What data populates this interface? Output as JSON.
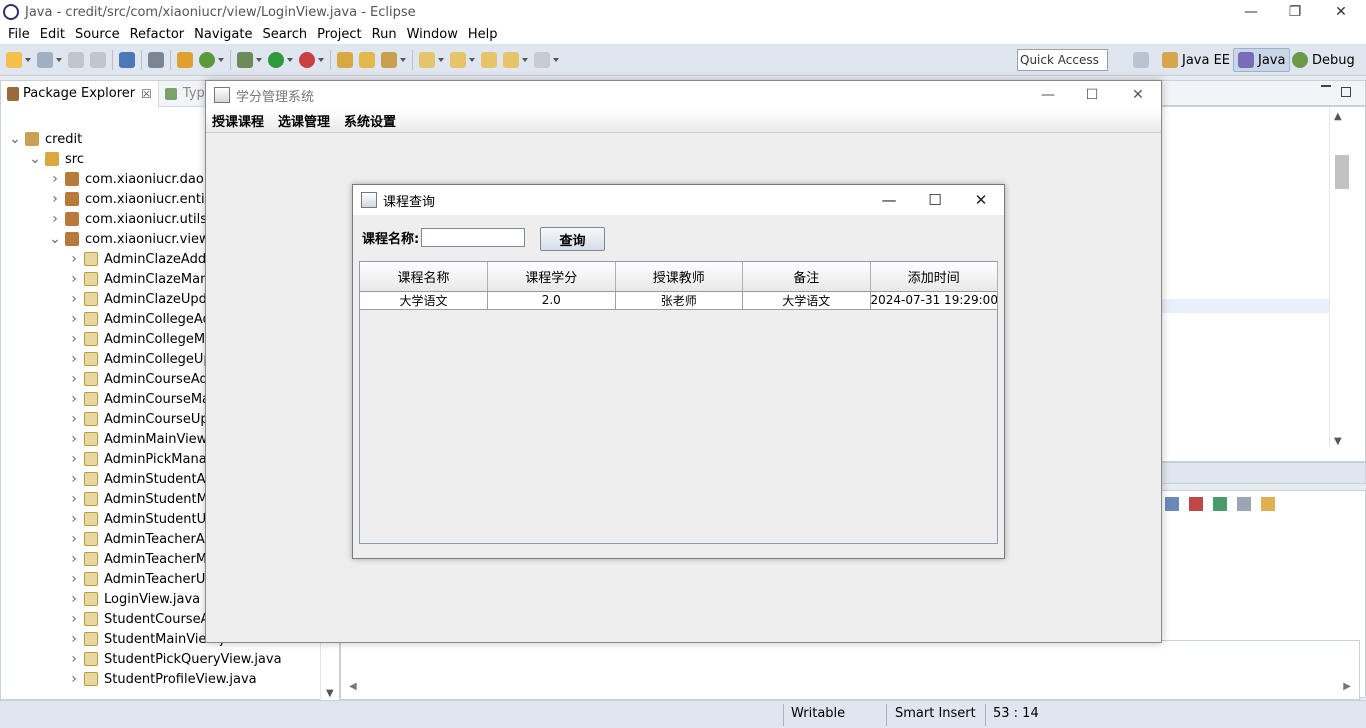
{
  "window": {
    "title": "Java - credit/src/com/xiaoniucr/view/LoginView.java - Eclipse"
  },
  "menu": [
    "File",
    "Edit",
    "Source",
    "Refactor",
    "Navigate",
    "Search",
    "Project",
    "Run",
    "Window",
    "Help"
  ],
  "quick_access": {
    "placeholder": "Quick Access"
  },
  "perspectives": [
    "Java EE",
    "Java",
    "Debug"
  ],
  "package_explorer": {
    "tab_label": "Package Explorer",
    "tab_close": "☒",
    "second_tab": "Type",
    "tree": [
      {
        "label": "credit",
        "level": 0,
        "expanded": true,
        "kind": "project"
      },
      {
        "label": "src",
        "level": 1,
        "expanded": true,
        "kind": "src"
      },
      {
        "label": "com.xiaoniucr.dao",
        "level": 2,
        "expanded": false,
        "kind": "package"
      },
      {
        "label": "com.xiaoniucr.entity",
        "level": 2,
        "expanded": false,
        "kind": "package"
      },
      {
        "label": "com.xiaoniucr.utils",
        "level": 2,
        "expanded": false,
        "kind": "package"
      },
      {
        "label": "com.xiaoniucr.view",
        "level": 2,
        "expanded": true,
        "kind": "package"
      },
      {
        "label": "AdminClazeAddV",
        "level": 3,
        "expanded": false,
        "kind": "java"
      },
      {
        "label": "AdminClazeMana",
        "level": 3,
        "expanded": false,
        "kind": "java"
      },
      {
        "label": "AdminClazeUpda",
        "level": 3,
        "expanded": false,
        "kind": "java"
      },
      {
        "label": "AdminCollegeAdc",
        "level": 3,
        "expanded": false,
        "kind": "java"
      },
      {
        "label": "AdminCollegeMa",
        "level": 3,
        "expanded": false,
        "kind": "java"
      },
      {
        "label": "AdminCollegeUpc",
        "level": 3,
        "expanded": false,
        "kind": "java"
      },
      {
        "label": "AdminCourseAdd",
        "level": 3,
        "expanded": false,
        "kind": "java"
      },
      {
        "label": "AdminCourseMan",
        "level": 3,
        "expanded": false,
        "kind": "java"
      },
      {
        "label": "AdminCourseUpc",
        "level": 3,
        "expanded": false,
        "kind": "java"
      },
      {
        "label": "AdminMainView.j",
        "level": 3,
        "expanded": false,
        "kind": "java"
      },
      {
        "label": "AdminPickManag",
        "level": 3,
        "expanded": false,
        "kind": "java"
      },
      {
        "label": "AdminStudentAdc",
        "level": 3,
        "expanded": false,
        "kind": "java"
      },
      {
        "label": "AdminStudentMa",
        "level": 3,
        "expanded": false,
        "kind": "java"
      },
      {
        "label": "AdminStudentUpc",
        "level": 3,
        "expanded": false,
        "kind": "java"
      },
      {
        "label": "AdminTeacherAd",
        "level": 3,
        "expanded": false,
        "kind": "java"
      },
      {
        "label": "AdminTeacherMa",
        "level": 3,
        "expanded": false,
        "kind": "java"
      },
      {
        "label": "AdminTeacherUp",
        "level": 3,
        "expanded": false,
        "kind": "java"
      },
      {
        "label": "LoginView.java",
        "level": 3,
        "expanded": false,
        "kind": "java"
      },
      {
        "label": "StudentCourseAll",
        "level": 3,
        "expanded": false,
        "kind": "java"
      },
      {
        "label": "StudentMainView.java",
        "level": 3,
        "expanded": false,
        "kind": "java"
      },
      {
        "label": "StudentPickQueryView.java",
        "level": 3,
        "expanded": false,
        "kind": "java"
      },
      {
        "label": "StudentProfileView.java",
        "level": 3,
        "expanded": false,
        "kind": "java"
      }
    ]
  },
  "main_frame": {
    "title": "学分管理系统",
    "menus": [
      "授课课程",
      "选课管理",
      "系统设置"
    ]
  },
  "inner_frame": {
    "title": "课程查询",
    "search_label": "课程名称:",
    "search_value": "",
    "search_button": "查询",
    "table": {
      "headers": [
        "课程名称",
        "课程学分",
        "授课教师",
        "备注",
        "添加时间"
      ],
      "rows": [
        [
          "大学语文",
          "2.0",
          "张老师",
          "大学语文",
          "2024-07-31 19:29:00"
        ]
      ]
    }
  },
  "status": {
    "writable": "Writable",
    "insert_mode": "Smart Insert",
    "position": "53 : 14"
  },
  "colors": {
    "toolbar": "#dfe6ef",
    "accent": "#c8d6e8",
    "swing_bg": "#eeeeee"
  }
}
